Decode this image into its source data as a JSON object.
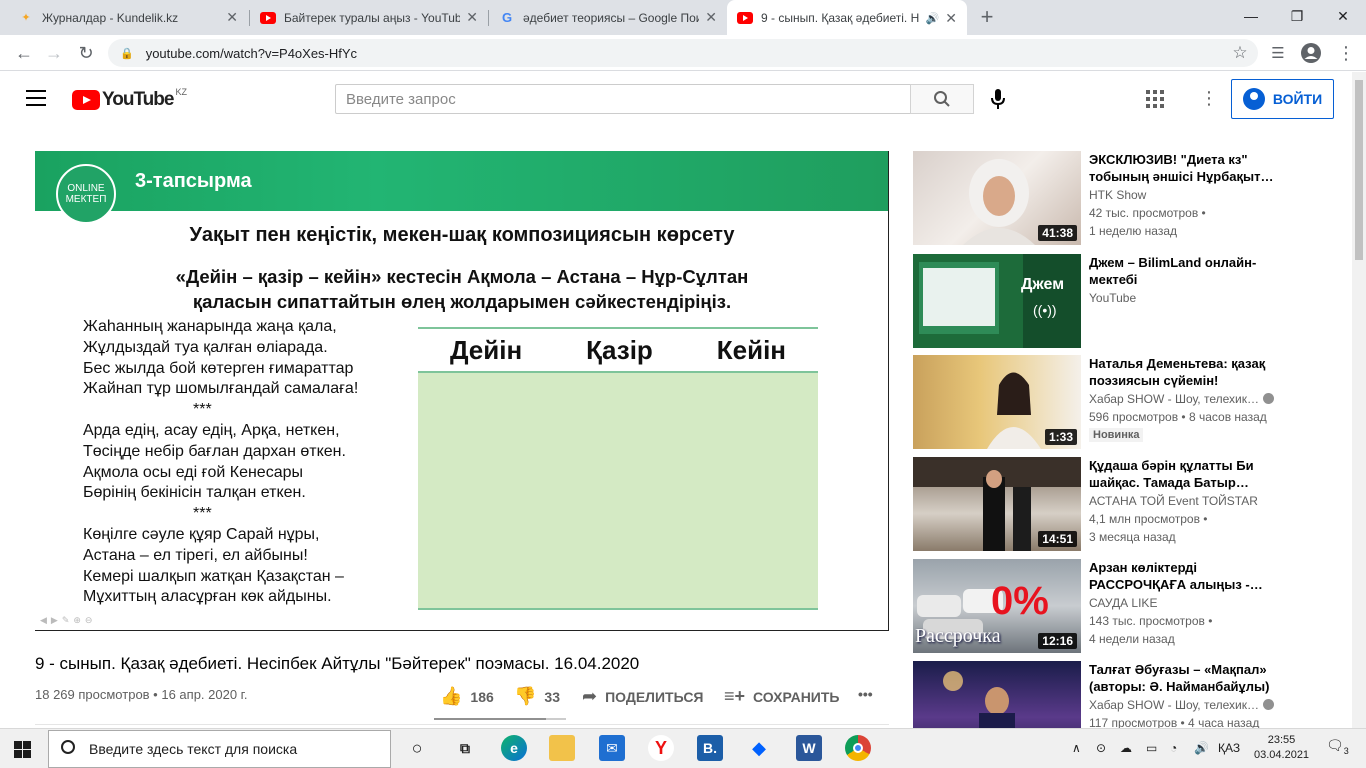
{
  "browser": {
    "tabs": [
      {
        "title": "Журналдар - Kundelik.kz",
        "icon": "kundelik-icon"
      },
      {
        "title": "Байтерек туралы аңыз - YouTub",
        "icon": "youtube-icon"
      },
      {
        "title": "әдебиет теориясы – Google Пои",
        "icon": "google-icon"
      },
      {
        "title": "9 - сынып. Қазақ әдебиеті. Н",
        "icon": "youtube-icon"
      }
    ],
    "new_tab": "+",
    "url": "youtube.com/watch?v=P4oXes-HfYc"
  },
  "yt": {
    "logo_text": "YouTube",
    "country": "KZ",
    "search_placeholder": "Введите запрос",
    "signin_label": "ВОЙТИ"
  },
  "slide": {
    "brand_line1": "ONLINE",
    "brand_line2": "МЕКТЕП",
    "task_label": "3-тапсырма",
    "heading": "Уақыт пен кеңістік, мекен-шақ композициясын көрсету",
    "instruction_line1": "«Дейін – қазір –  кейін» кестесін Ақмола – Астана – Нұр-Сұлтан",
    "instruction_line2": "қаласын сипаттайтын өлең жолдарымен сәйкестендіріңіз.",
    "poem": [
      "Жаһанның жанарында жаңа қала,",
      "Жұлдыздай туа қалған өліарада.",
      "Бес жылда бой көтерген ғимараттар",
      "Жайнап тұр шомылғандай самалаға!",
      "***",
      "Арда едің, асау едің, Арқа, неткен,",
      "Төсіңде небір бағлан дархан өткен.",
      "Ақмола осы еді ғой Кенесары",
      "Бөрінің бекінісін талқан еткен.",
      "***",
      "Көңілге сәуле құяр Сарай нұры,",
      "Астана – ел тірегі, ел айбыны!",
      "Кемері шалқып жатқан Қазақстан –",
      "Мұхиттың аласұрған көк айдыны."
    ],
    "table_headers": [
      "Дейін",
      "Қазір",
      "Кейін"
    ]
  },
  "video": {
    "title": "9 - сынып. Қазақ әдебиеті. Несіпбек Айтұлы \"Бәйтерек\" поэмасы. 16.04.2020",
    "views_date": "18 269 просмотров • 16 апр. 2020 г.",
    "likes": "186",
    "dislikes": "33",
    "share_label": "ПОДЕЛИТЬСЯ",
    "save_label": "СОХРАНИТЬ",
    "like_ratio": 0.85
  },
  "recommendations": [
    {
      "title": "ЭКСКЛЮЗИВ! \"Диета кз\" тобының әншісі Нұрбақыт…",
      "channel": "HTK Show",
      "line2": "42 тыс. просмотров •",
      "line3": "1 неделю назад",
      "duration": "41:38"
    },
    {
      "title": "Джем – BilimLand онлайн-мектебі",
      "channel": "YouTube",
      "line2": "",
      "line3": "",
      "duration": "",
      "overlay": "Джем"
    },
    {
      "title": "Наталья Деменьтева: қазақ поэзиясын сүйемін!",
      "channel": "Хабар SHOW - Шоу, телехик…",
      "line2": "596 просмотров • 8 часов назад",
      "line3": "",
      "badge": "Новинка",
      "duration": "1:33"
    },
    {
      "title": "Құдаша бәрін құлатты Би шайқас. Тамада Батыр…",
      "channel": "АСТАНА ТОЙ Event ТОЙSTAR",
      "line2": "4,1 млн просмотров •",
      "line3": "3 месяца назад",
      "duration": "14:51"
    },
    {
      "title": "Арзан көліктерді РАССРОЧҚАҒА алыңыз -…",
      "channel": "САУДА LIKE",
      "line2": "143 тыс. просмотров •",
      "line3": "4 недели назад",
      "duration": "12:16",
      "overlay": "0%",
      "overlay2": "Рассрочка"
    },
    {
      "title": "Талғат Әбуғазы – «Мақпал» (авторы: Ә. Найманбайұлы)",
      "channel": "Хабар SHOW - Шоу, телехик…",
      "line2": "117 просмотров • 4 часа назад",
      "line3": "",
      "duration": ""
    }
  ],
  "taskbar": {
    "search_placeholder": "Введите здесь текст для поиска",
    "lang": "ҚАЗ",
    "time": "23:55",
    "date": "03.04.2021",
    "notifications": "3"
  }
}
